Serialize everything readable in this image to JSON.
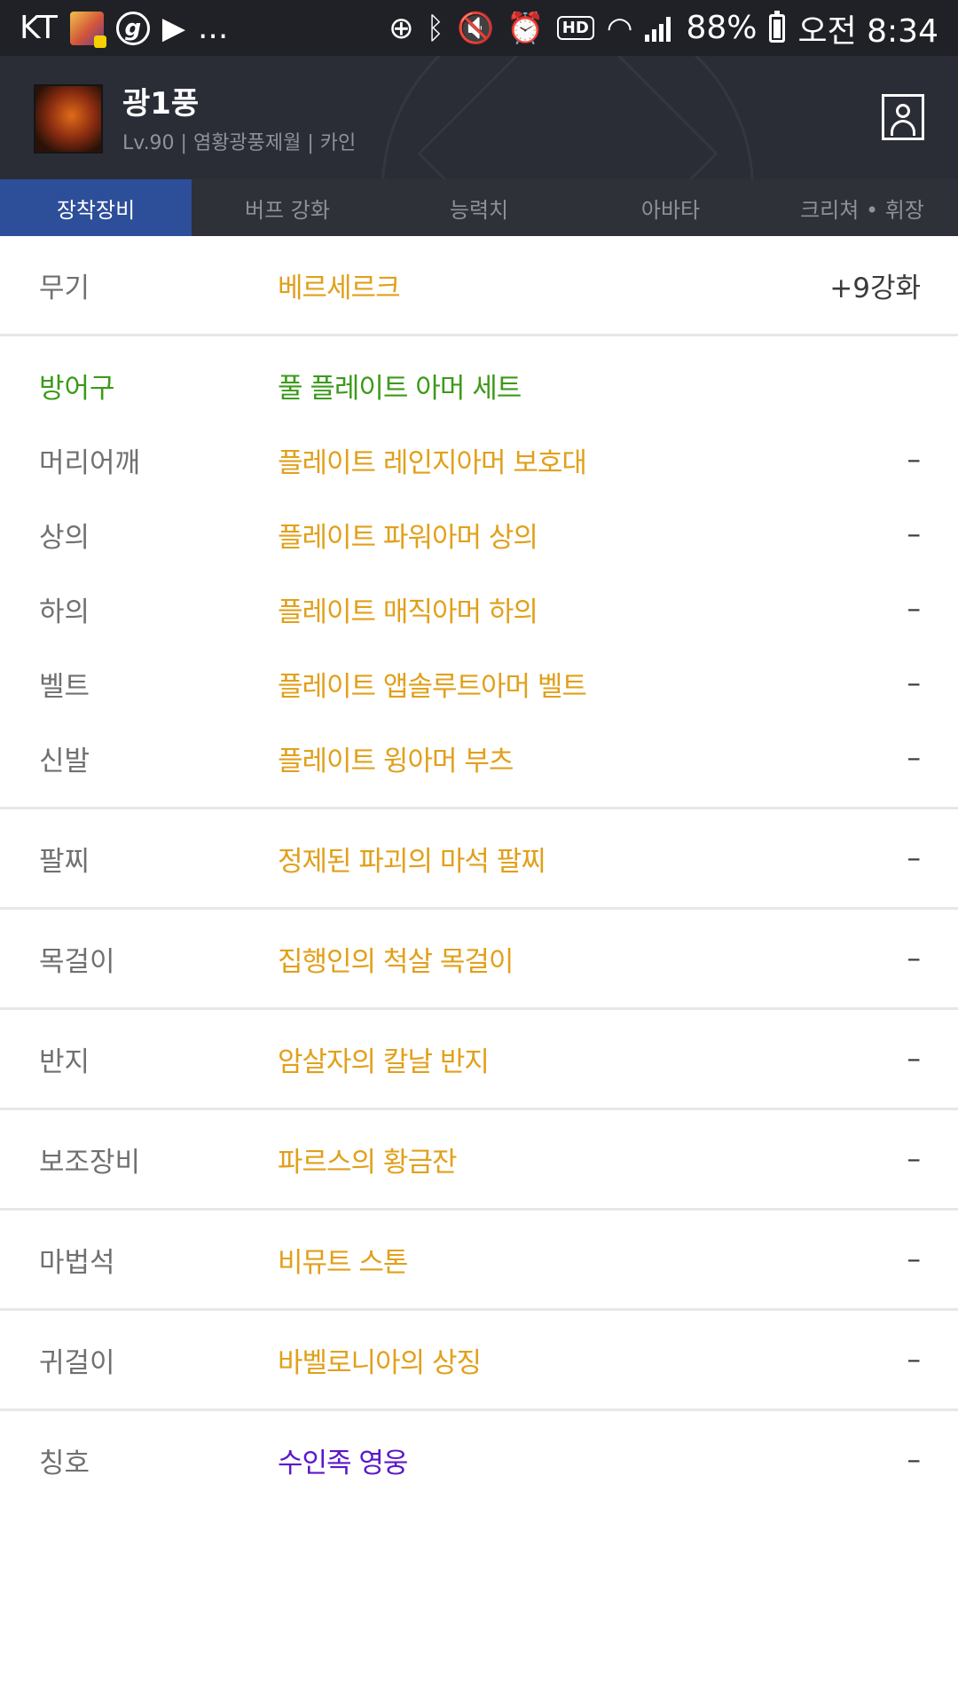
{
  "status_bar": {
    "carrier": "KT",
    "dots": "...",
    "battery": "88%",
    "time": "오전 8:34"
  },
  "profile": {
    "name": "광1풍",
    "subtitle": "Lv.90 | 염황광풍제월 | 카인"
  },
  "tabs": [
    "장착장비",
    "버프 강화",
    "능력치",
    "아바타",
    "크리쳐 • 휘장"
  ],
  "equipment": {
    "weapon": {
      "slot": "무기",
      "item": "베르세르크",
      "enhance": "+9강화"
    },
    "armor_set": {
      "slot": "방어구",
      "item": "풀 플레이트 아머 세트"
    },
    "armor": [
      {
        "slot": "머리어깨",
        "item": "플레이트 레인지아머 보호대",
        "enhance": "–"
      },
      {
        "slot": "상의",
        "item": "플레이트 파워아머 상의",
        "enhance": "–"
      },
      {
        "slot": "하의",
        "item": "플레이트 매직아머 하의",
        "enhance": "–"
      },
      {
        "slot": "벨트",
        "item": "플레이트 앱솔루트아머 벨트",
        "enhance": "–"
      },
      {
        "slot": "신발",
        "item": "플레이트 윙아머 부츠",
        "enhance": "–"
      }
    ],
    "accessories": [
      {
        "slot": "팔찌",
        "item": "정제된 파괴의 마석 팔찌",
        "enhance": "–"
      },
      {
        "slot": "목걸이",
        "item": "집행인의 척살 목걸이",
        "enhance": "–"
      },
      {
        "slot": "반지",
        "item": "암살자의 칼날 반지",
        "enhance": "–"
      },
      {
        "slot": "보조장비",
        "item": "파르스의 황금잔",
        "enhance": "–"
      },
      {
        "slot": "마법석",
        "item": "비뮤트 스톤",
        "enhance": "–"
      },
      {
        "slot": "귀걸이",
        "item": "바벨로니아의 상징",
        "enhance": "–"
      },
      {
        "slot": "칭호",
        "item": "수인족 영웅",
        "enhance": "–"
      }
    ]
  },
  "colors": {
    "item_gold": "#e1a01b",
    "set_green": "#3c9a1a",
    "title_purple": "#5b18c9",
    "tab_active": "#2d4e99"
  }
}
